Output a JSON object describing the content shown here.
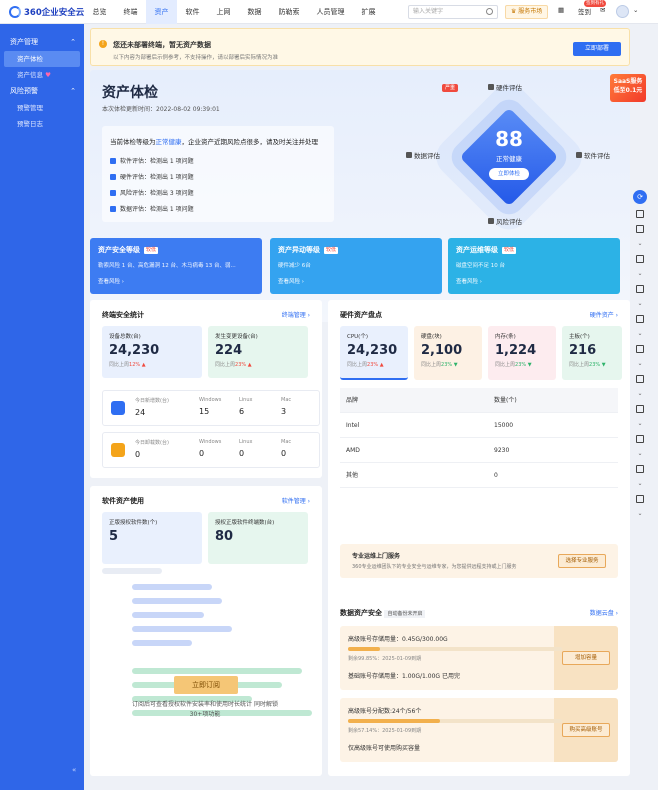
{
  "topbar": {
    "logo": "360企业安全云",
    "nav": [
      "总览",
      "终端",
      "资产",
      "软件",
      "上网",
      "数据",
      "防勒索",
      "人员管理",
      "扩展"
    ],
    "active_nav": "资产",
    "search_placeholder": "输入关键字",
    "service_market": "服务市场",
    "signin": "签到",
    "signin_badge": "签到有礼"
  },
  "sidebar": {
    "group1": "资产管理",
    "group1_items": [
      "资产体检",
      "资产信息"
    ],
    "group2": "风险预警",
    "group2_items": [
      "预警管理",
      "预警日志"
    ],
    "active_item": "资产体检"
  },
  "notice": {
    "title": "您还未部署终端，暂无资产数据",
    "desc": "以下内容为部署后示例参考，不支持操作，请以部署后实际情况为准",
    "button": "立即部署"
  },
  "hero": {
    "title": "资产体检",
    "updated": "本次体检更新时间：2022-08-02 09:39:01",
    "summary_prefix": "当前体检等级为",
    "summary_level": "正常健康",
    "summary_suffix": "，企业资产近期风险点很多，请及时关注并处理",
    "lines": [
      "软件评估：检测出 1 项问题",
      "硬件评估：检测出 1 项问题",
      "风险评估：检测出 3 项问题",
      "数据评估：检测出 1 项问题"
    ],
    "score": "88",
    "score_label": "正常健康",
    "score_button": "立即体检",
    "axis_top": "硬件评估",
    "axis_left": "数据评估",
    "axis_right": "软件评估",
    "axis_bottom": "风险评估",
    "red_tag": "严重",
    "promo_line1": "SaaS服务",
    "promo_line2": "低至0.1元"
  },
  "grade_cards": [
    {
      "title": "资产安全等级",
      "tag": "较低",
      "desc": "勒索风险 1 台、高危漏洞 12 台、木马病毒 13 台、弱...",
      "link": "查看风险 ›",
      "color": "#3d7cf2"
    },
    {
      "title": "资产异动等级",
      "tag": "较低",
      "desc": "硬件减少 6台",
      "link": "查看风险 ›",
      "color": "#34a3f0"
    },
    {
      "title": "资产运维等级",
      "tag": "较低",
      "desc": "磁盘空间不足 10 台",
      "link": "查看风险 ›",
      "color": "#2cb2e6"
    }
  ],
  "terminal_stats": {
    "title": "终端安全统计",
    "link": "终端管理 ›",
    "devices_label": "设备总数(台)",
    "devices_value": "24,230",
    "devices_change": "同比上周",
    "devices_pct": "12% ▲",
    "changed_label": "发生变更设备(台)",
    "changed_value": "224",
    "changed_change": "同比上周",
    "changed_pct": "23% ▲",
    "row1": {
      "k0": "今日新增数(台)",
      "v0": "24",
      "k1": "Windows",
      "v1": "15",
      "k2": "Linux",
      "v2": "6",
      "k3": "Mac",
      "v3": "3"
    },
    "row2": {
      "k0": "今日卸载数(台)",
      "v0": "0",
      "k1": "Windows",
      "v1": "0",
      "k2": "Linux",
      "v2": "0",
      "k3": "Mac",
      "v3": "0"
    }
  },
  "hardware": {
    "title": "硬件资产盘点",
    "link": "硬件资产 ›",
    "cards": [
      {
        "k": "CPU(个)",
        "v": "24,230",
        "s": "同比上周",
        "p": "23% ▲"
      },
      {
        "k": "硬盘(块)",
        "v": "2,100",
        "s": "同比上周",
        "p": "23% ▼"
      },
      {
        "k": "内存(条)",
        "v": "1,224",
        "s": "同比上周",
        "p": "23% ▼"
      },
      {
        "k": "主板(个)",
        "v": "216",
        "s": "同比上周",
        "p": "23% ▼"
      }
    ],
    "table_head": [
      "品牌",
      "数量(个)"
    ],
    "table_rows": [
      [
        "Intel",
        "15000"
      ],
      [
        "AMD",
        "9230"
      ],
      [
        "其他",
        "0"
      ]
    ],
    "ops_title": "专业运维上门服务",
    "ops_desc": "360专业运维团队下的专业安全与运维专家，为您提供远程支持或上门服务",
    "ops_button": "选择专业服务"
  },
  "software": {
    "title": "软件资产使用",
    "link": "软件管理 ›",
    "authorized_label": "正版授权软件数(个)",
    "authorized_value": "5",
    "terminals_label": "授权正版软件终端数(台)",
    "terminals_value": "80",
    "subscribe_button": "立即订阅",
    "subscribe_text": "订阅后可查看授权软件安装率和使用时长统计 同时解锁30+项功能"
  },
  "data_security": {
    "title": "数据资产安全",
    "tag": "自动备份未开启",
    "link": "数据云盘 ›",
    "box1_title": "高级账号存储用量：0.45G/300.00G",
    "box1_fill": 0.15,
    "box1_sub": "剩余99.85%：2025-01-09到期",
    "box1_line2": "基础账号存储用量：1.00G/1.00G 已用完",
    "box1_button": "增加容量",
    "box2_title": "高级账号分配数:24个/56个",
    "box2_fill": 0.43,
    "box2_sub": "剩余57.14%：2025-01-09到期",
    "box2_line2": "仅高级账号可使用购买容量",
    "box2_button": "购买高级账号"
  }
}
